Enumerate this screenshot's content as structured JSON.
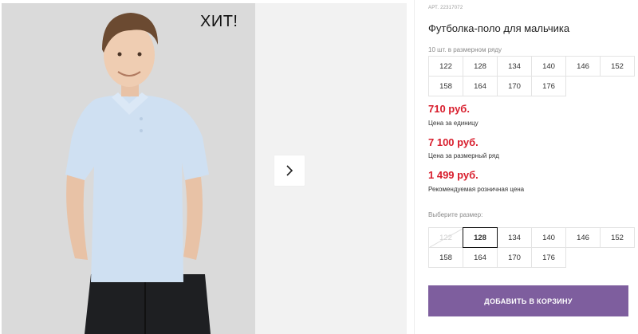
{
  "gallery": {
    "badge": "ХИТ!",
    "next_icon": "chevron-right-icon"
  },
  "product": {
    "article": "АРТ. 22317072",
    "title": "Футболка-поло для мальчика",
    "size_row_caption": "10 шт. в размерном ряду",
    "size_row": [
      "122",
      "128",
      "134",
      "140",
      "146",
      "152",
      "158",
      "164",
      "170",
      "176"
    ],
    "prices": [
      {
        "value": "710 руб.",
        "label": "Цена за единицу"
      },
      {
        "value": "7 100 руб.",
        "label": "Цена за размерный ряд"
      },
      {
        "value": "1 499 руб.",
        "label": "Рекомендуемая розничная цена"
      }
    ],
    "choose_size_label": "Выберите размер:",
    "sizes": [
      {
        "label": "122",
        "state": "disabled"
      },
      {
        "label": "128",
        "state": "selected"
      },
      {
        "label": "134",
        "state": "available"
      },
      {
        "label": "140",
        "state": "available"
      },
      {
        "label": "146",
        "state": "available"
      },
      {
        "label": "152",
        "state": "available"
      },
      {
        "label": "158",
        "state": "available"
      },
      {
        "label": "164",
        "state": "available"
      },
      {
        "label": "170",
        "state": "available"
      },
      {
        "label": "176",
        "state": "available"
      }
    ],
    "add_to_cart": "ДОБАВИТЬ В КОРЗИНУ"
  },
  "colors": {
    "price": "#d81d2c",
    "button": "#7e5e9e",
    "shirt": "#cfe0f2"
  }
}
